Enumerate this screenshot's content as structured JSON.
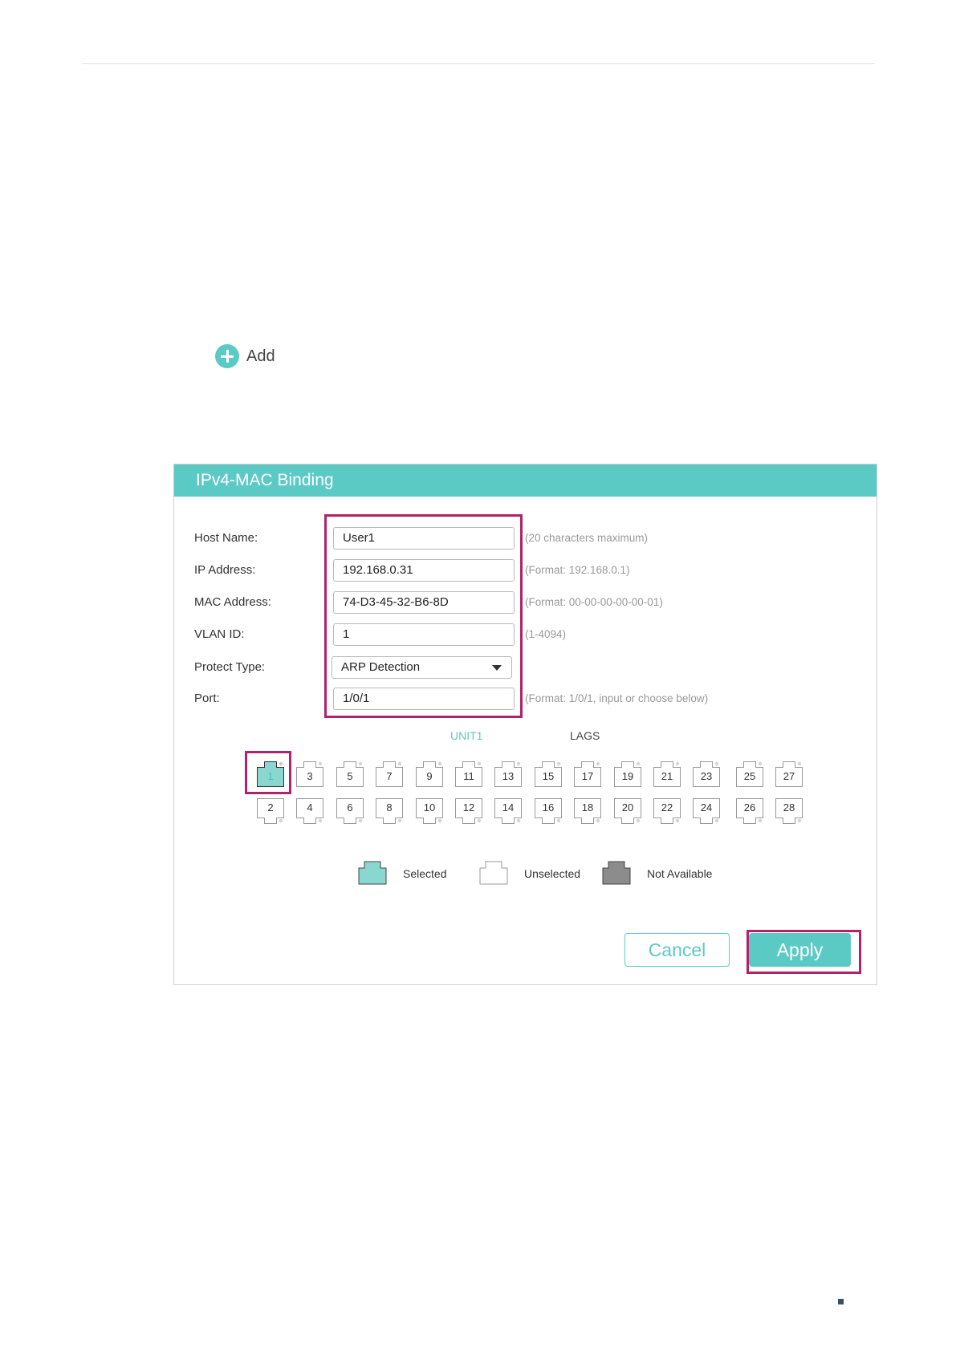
{
  "add_label": "Add",
  "panel": {
    "title": "IPv4-MAC Binding",
    "fields": {
      "host_name": {
        "label": "Host Name:",
        "value": "User1",
        "hint": "(20 characters maximum)"
      },
      "ip_address": {
        "label": "IP Address:",
        "value": "192.168.0.31",
        "hint": "(Format: 192.168.0.1)"
      },
      "mac_address": {
        "label": "MAC Address:",
        "value": "74-D3-45-32-B6-8D",
        "hint": "(Format: 00-00-00-00-00-01)"
      },
      "vlan_id": {
        "label": "VLAN ID:",
        "value": "1",
        "hint": "(1-4094)"
      },
      "protect_type": {
        "label": "Protect Type:",
        "value": "ARP Detection"
      },
      "port": {
        "label": "Port:",
        "value": "1/0/1",
        "hint": "(Format: 1/0/1, input or choose below)"
      }
    },
    "tabs": {
      "unit": "UNIT1",
      "lags": "LAGS"
    },
    "ports": {
      "top": [
        "1",
        "3",
        "5",
        "7",
        "9",
        "11",
        "13",
        "15",
        "17",
        "19",
        "21",
        "23",
        "25",
        "27"
      ],
      "bottom": [
        "2",
        "4",
        "6",
        "8",
        "10",
        "12",
        "14",
        "16",
        "18",
        "20",
        "22",
        "24",
        "26",
        "28"
      ],
      "selected": [
        "1"
      ]
    },
    "legend": {
      "selected": "Selected",
      "unselected": "Unselected",
      "not_available": "Not Available"
    },
    "buttons": {
      "cancel": "Cancel",
      "apply": "Apply"
    }
  },
  "colors": {
    "accent": "#5ccac4",
    "highlight": "#b0216e",
    "not_available": "#8c8c8c"
  }
}
